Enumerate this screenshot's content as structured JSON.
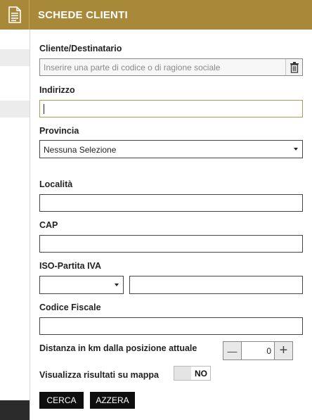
{
  "header": {
    "title": "SCHEDE CLIENTI",
    "icon": "document-icon"
  },
  "form": {
    "cliente": {
      "label": "Cliente/Destinatario",
      "placeholder": "Inserire una parte di codice o di ragione sociale",
      "clear_icon": "trash-icon"
    },
    "indirizzo": {
      "label": "Indirizzo",
      "value": ""
    },
    "provincia": {
      "label": "Provincia",
      "selected": "Nessuna Selezione"
    },
    "localita": {
      "label": "Località",
      "value": ""
    },
    "cap": {
      "label": "CAP",
      "value": ""
    },
    "iso_piva": {
      "label": "ISO-Partita IVA",
      "iso": "",
      "piva": ""
    },
    "codice_fiscale": {
      "label": "Codice Fiscale",
      "value": ""
    },
    "distanza": {
      "label": "Distanza in km dalla posizione attuale",
      "value": "0",
      "minus": "—",
      "plus": "+"
    },
    "mappa": {
      "label": "Visualizza risultati su mappa",
      "toggle": "NO"
    },
    "buttons": {
      "search": "CERCA",
      "reset": "AZZERA"
    }
  },
  "colors": {
    "header": "#a8893a",
    "button": "#0f0f0f",
    "focus_border": "#b39a55"
  }
}
